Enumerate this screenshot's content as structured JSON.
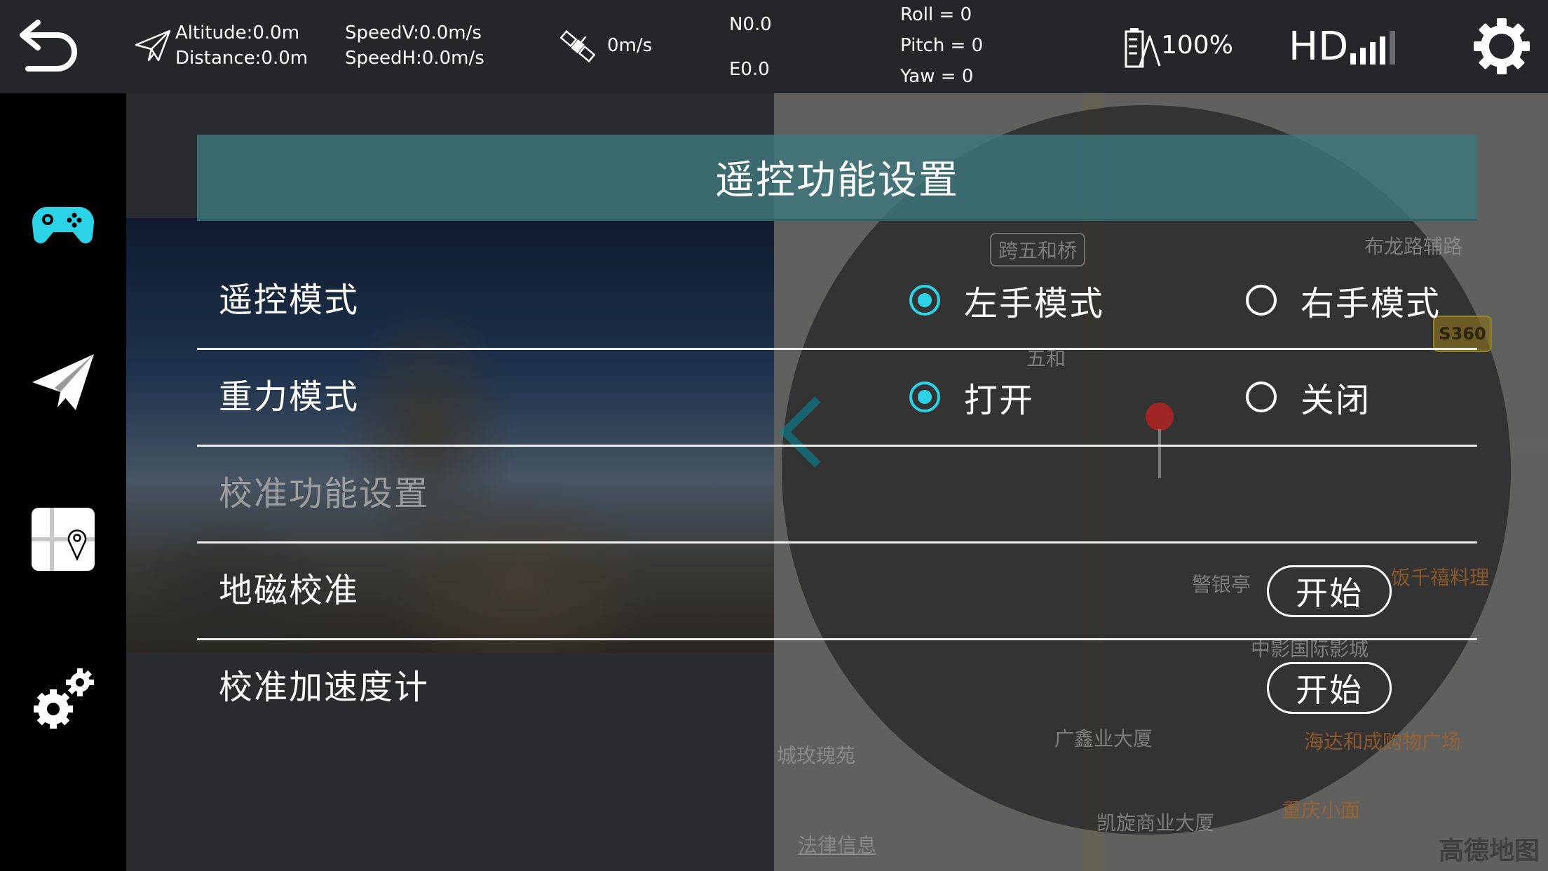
{
  "status": {
    "altitude": "Altitude:0.0m",
    "distance": "Distance:0.0m",
    "speed_v": "SpeedV:0.0m/s",
    "speed_h": "SpeedH:0.0m/s",
    "gps_speed": "0m/s",
    "north": "N0.0",
    "east": "E0.0",
    "roll": "Roll = 0",
    "pitch": "Pitch = 0",
    "yaw": "Yaw = 0",
    "battery": "100%",
    "signal_label": "HD"
  },
  "icons": {
    "back": "back-arrow-icon",
    "plane": "paper-plane-icon",
    "satellite": "satellite-icon",
    "battery": "battery-icon",
    "signal": "signal-bars-icon",
    "settings": "gear-icon",
    "gamepad": "gamepad-icon",
    "map": "map-pin-icon",
    "gears": "gears-icon"
  },
  "colors": {
    "accent": "#2cd3e6",
    "title_bar": "#3e787c"
  },
  "panel": {
    "title": "遥控功能设置",
    "rc_mode": {
      "label": "遥控模式",
      "options": [
        "左手模式",
        "右手模式"
      ],
      "selected": "左手模式"
    },
    "gravity_mode": {
      "label": "重力模式",
      "options": [
        "打开",
        "关闭"
      ],
      "selected": "打开"
    },
    "calibration_header": "校准功能设置",
    "compass": {
      "label": "地磁校准",
      "button": "开始"
    },
    "accelerometer": {
      "label": "校准加速度计",
      "button": "开始"
    }
  },
  "map_labels": {
    "bridge": "跨五和桥",
    "road": "布龙路辅路",
    "road_shield": "S360",
    "wuhe": "五和",
    "jingting": "警银亭",
    "restaurant": "饭千禧料理",
    "mall_theater": "中影国际影城",
    "guangxin": "广鑫业大厦",
    "haida": "海达和成购物广场",
    "rose_garden": "城玫瑰苑",
    "kaixuan": "凯旋商业大厦",
    "noodles": "重庆小面",
    "law_info": "法律信息",
    "amap": "高德地图"
  }
}
